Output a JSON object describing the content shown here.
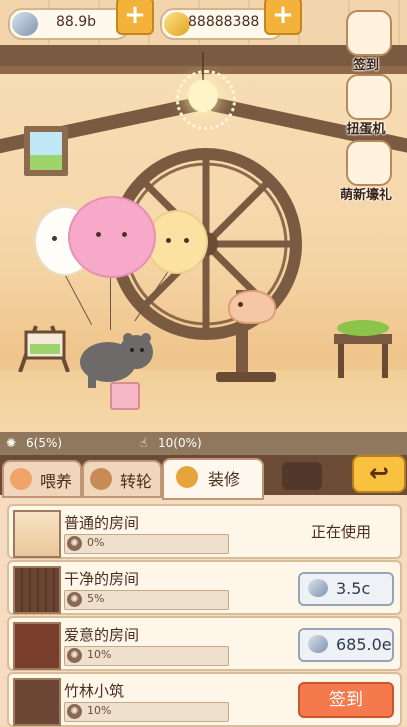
{
  "currency": {
    "seeds": "88.9b",
    "coins": "88888388"
  },
  "side_buttons": [
    {
      "label": "签到",
      "icon": "calendar-icon"
    },
    {
      "label": "扭蛋机",
      "icon": "gacha-machine-icon"
    },
    {
      "label": "萌新壕礼",
      "icon": "newbie-gift-icon"
    }
  ],
  "stats": {
    "wheel": "6(5%)",
    "tap": "10(0%)"
  },
  "tabs": [
    {
      "label": "喂养",
      "icon": "food-bowl-icon",
      "active": false
    },
    {
      "label": "转轮",
      "icon": "wheel-icon",
      "active": false
    },
    {
      "label": "装修",
      "icon": "plant-pot-icon",
      "active": true
    }
  ],
  "back_icon": "back-arrow-icon",
  "rooms": [
    {
      "name": "普通的房间",
      "progress": "0%",
      "action": "status",
      "status": "正在使用"
    },
    {
      "name": "干净的房间",
      "progress": "5%",
      "action": "buy",
      "price": "3.5c"
    },
    {
      "name": "爱意的房间",
      "progress": "10%",
      "action": "buy",
      "price": "685.0e"
    },
    {
      "name": "竹林小筑",
      "progress": "10%",
      "action": "sign",
      "button": "签到"
    }
  ],
  "colors": {
    "accent": "#f3b23a",
    "sign_button": "#f47a4e",
    "panel": "#f5dcc0",
    "beam": "#7a5a40"
  }
}
